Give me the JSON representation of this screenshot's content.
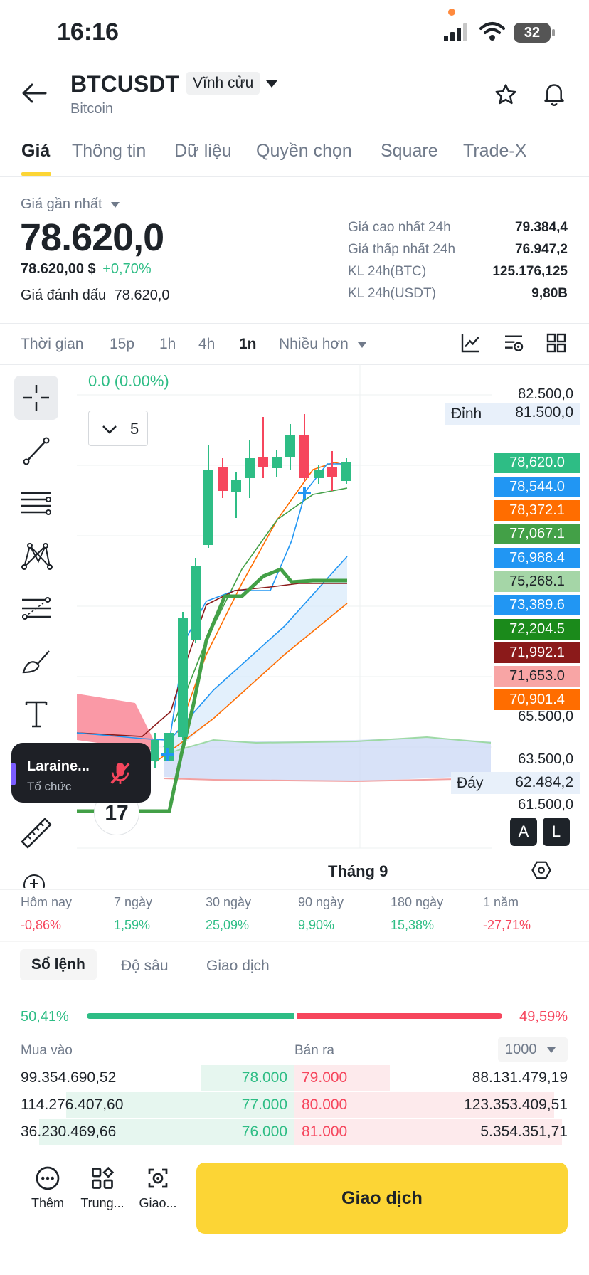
{
  "status_bar": {
    "time": "16:16",
    "battery": "32"
  },
  "header": {
    "symbol": "BTCUSDT",
    "contract_type": "Vĩnh cửu",
    "subtitle": "Bitcoin",
    "icons": [
      "back-arrow-icon",
      "chevron-down-icon",
      "star-icon",
      "bell-icon"
    ]
  },
  "tabs": [
    "Giá",
    "Thông tin",
    "Dữ liệu",
    "Quyền chọn",
    "Square",
    "Trade-X"
  ],
  "price": {
    "last_label": "Giá gần nhất",
    "last": "78.620,0",
    "usd": "78.620,00 $",
    "change": "+0,70%",
    "mark_label": "Giá đánh dấu",
    "mark": "78.620,0"
  },
  "stats": [
    {
      "label": "Giá cao nhất 24h",
      "value": "79.384,4"
    },
    {
      "label": "Giá thấp nhất 24h",
      "value": "76.947,2"
    },
    {
      "label": "KL 24h(BTC)",
      "value": "125.176,125"
    },
    {
      "label": "KL 24h(USDT)",
      "value": "9,80B"
    }
  ],
  "intervals": {
    "items": [
      "Thời gian",
      "15p",
      "1h",
      "4h",
      "1n",
      "Nhiều hơn"
    ],
    "active": "1n"
  },
  "chart": {
    "change_text": "0.0 (0.00%)",
    "indicator_count": "5",
    "top_label": "Đỉnh",
    "bottom_label": "Đáy",
    "x_label": "Tháng 9",
    "axis": [
      "82.500,0",
      "81.500,0",
      "65.500,0",
      "63.500,0",
      "62.484,2",
      "61.500,0"
    ],
    "price_tags": [
      {
        "value": "78,620.0",
        "color": "#2ebd85"
      },
      {
        "value": "78,544.0",
        "color": "#2196f3"
      },
      {
        "value": "78,372.1",
        "color": "#ff6d00"
      },
      {
        "value": "77,067.1",
        "color": "#43a047"
      },
      {
        "value": "76,988.4",
        "color": "#2196f3"
      },
      {
        "value": "75,268.1",
        "color": "#a5d6a7"
      },
      {
        "value": "73,389.6",
        "color": "#2196f3"
      },
      {
        "value": "72,204.5",
        "color": "#1b8a1b"
      },
      {
        "value": "71,992.1",
        "color": "#8b1a1a"
      },
      {
        "value": "71,653.0",
        "color": "#f8a5a5"
      },
      {
        "value": "70,901.4",
        "color": "#ff6d00"
      }
    ],
    "ab_buttons": [
      "A",
      "L"
    ],
    "tradingview_mark": "17"
  },
  "call": {
    "name": "Laraine...",
    "role": "Tổ chức"
  },
  "periods": [
    {
      "label": "Hôm nay",
      "value": "-0,86%",
      "dir": "down"
    },
    {
      "label": "7 ngày",
      "value": "1,59%",
      "dir": "up"
    },
    {
      "label": "30 ngày",
      "value": "25,09%",
      "dir": "up"
    },
    {
      "label": "90 ngày",
      "value": "9,90%",
      "dir": "up"
    },
    {
      "label": "180 ngày",
      "value": "15,38%",
      "dir": "up"
    },
    {
      "label": "1 năm",
      "value": "-27,71%",
      "dir": "down"
    }
  ],
  "orderbook": {
    "tabs": [
      "Sổ lệnh",
      "Độ sâu",
      "Giao dịch"
    ],
    "buy_pct": "50,41%",
    "sell_pct": "49,59%",
    "buy_ratio": 0.5041,
    "buy_label": "Mua vào",
    "sell_label": "Bán ra",
    "depth": "1000",
    "rows": [
      {
        "bid_qty": "99.354.690,52",
        "bid_price": "78.000",
        "ask_price": "79.000",
        "ask_qty": "88.131.479,19",
        "bid_depth": 0.35,
        "ask_depth": 0.35
      },
      {
        "bid_qty": "114.276.407,60",
        "bid_price": "77.000",
        "ask_price": "80.000",
        "ask_qty": "123.353.409,51",
        "bid_depth": 0.85,
        "ask_depth": 0.95
      },
      {
        "bid_qty": "36.230.469,66",
        "bid_price": "76.000",
        "ask_price": "81.000",
        "ask_qty": "5.354.351,71",
        "bid_depth": 0.95,
        "ask_depth": 0.98
      }
    ]
  },
  "bottom_bar": {
    "items": [
      {
        "label": "Thêm",
        "icon": "more-dots-icon"
      },
      {
        "label": "Trung...",
        "icon": "grid-icon"
      },
      {
        "label": "Giao...",
        "icon": "trade-bot-icon"
      }
    ],
    "trade_button": "Giao dịch"
  }
}
